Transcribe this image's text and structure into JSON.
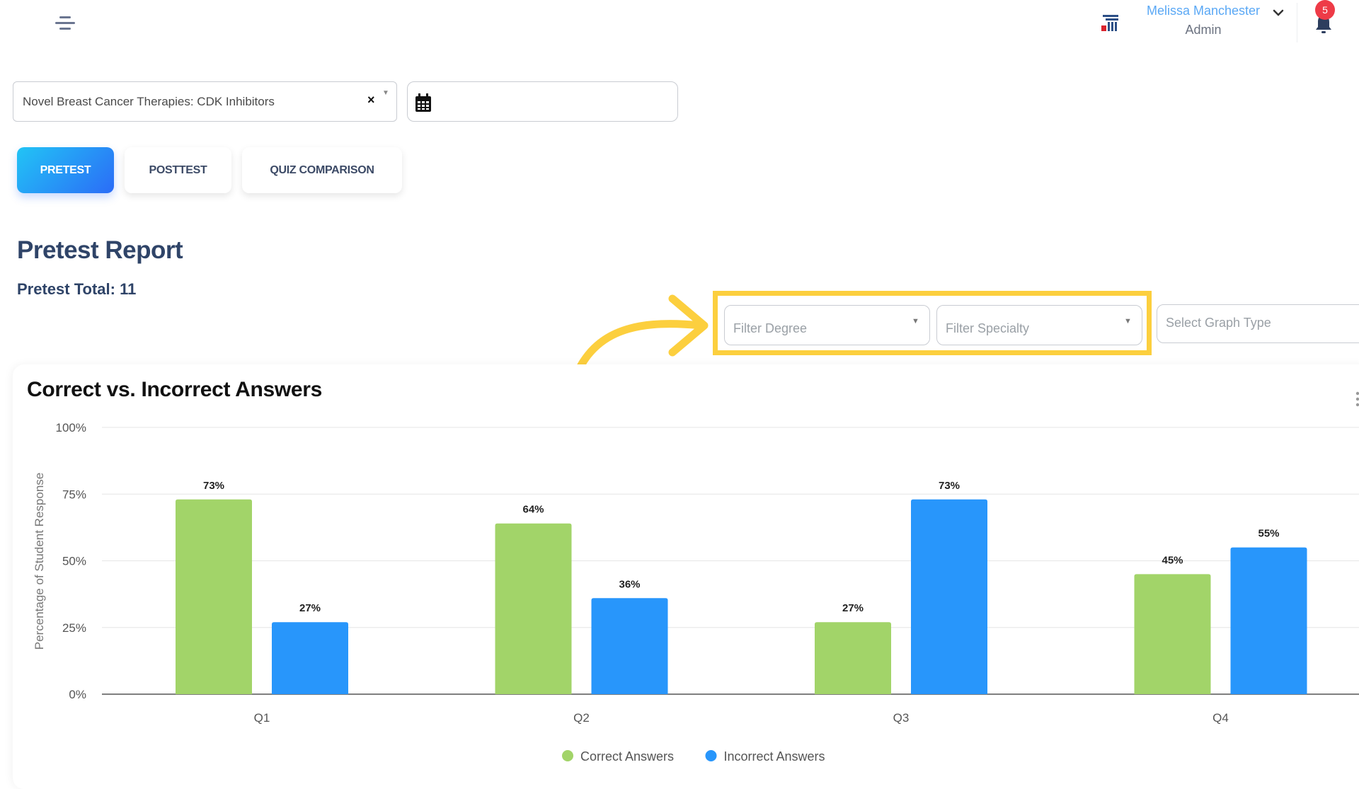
{
  "header": {
    "menu_icon": "hamburger-menu-icon",
    "logo_icon": "brand-logo-icon",
    "user_name": "Melissa Manchester",
    "user_role": "Admin",
    "notification_count": "5",
    "colors": {
      "user_name": "#5aa8f5",
      "badge": "#ee3b47"
    }
  },
  "filters_top": {
    "course_value": "Novel Breast Cancer Therapies: CDK Inhibitors",
    "clear_glyph": "×",
    "caret_glyph": "▼",
    "date_value": ""
  },
  "tabs": [
    {
      "label": "PRETEST",
      "active": true
    },
    {
      "label": "POSTTEST",
      "active": false
    },
    {
      "label": "QUIZ COMPARISON",
      "active": false
    }
  ],
  "report": {
    "title": "Pretest Report",
    "total": "Pretest Total: 11"
  },
  "graph_filters": {
    "degree_placeholder": "Filter Degree",
    "specialty_placeholder": "Filter Specialty",
    "graph_type_placeholder": "Select Graph Type",
    "caret_glyph": "▼",
    "highlight_color": "#fccf3e"
  },
  "chart_data": {
    "type": "bar",
    "title": "Correct vs. Incorrect Answers",
    "xlabel": "",
    "ylabel": "Percentage of Student Response",
    "categories": [
      "Q1",
      "Q2",
      "Q3",
      "Q4"
    ],
    "series": [
      {
        "name": "Correct Answers",
        "color": "#a2d469",
        "values": [
          73,
          64,
          27,
          45
        ]
      },
      {
        "name": "Incorrect Answers",
        "color": "#2896fb",
        "values": [
          27,
          36,
          73,
          55
        ]
      }
    ],
    "ylim": [
      0,
      100
    ],
    "yticks": [
      0,
      25,
      50,
      75,
      100
    ],
    "ytick_labels": [
      "0%",
      "25%",
      "50%",
      "75%",
      "100%"
    ],
    "value_suffix": "%",
    "grid": true,
    "legend": "bottom-center"
  }
}
